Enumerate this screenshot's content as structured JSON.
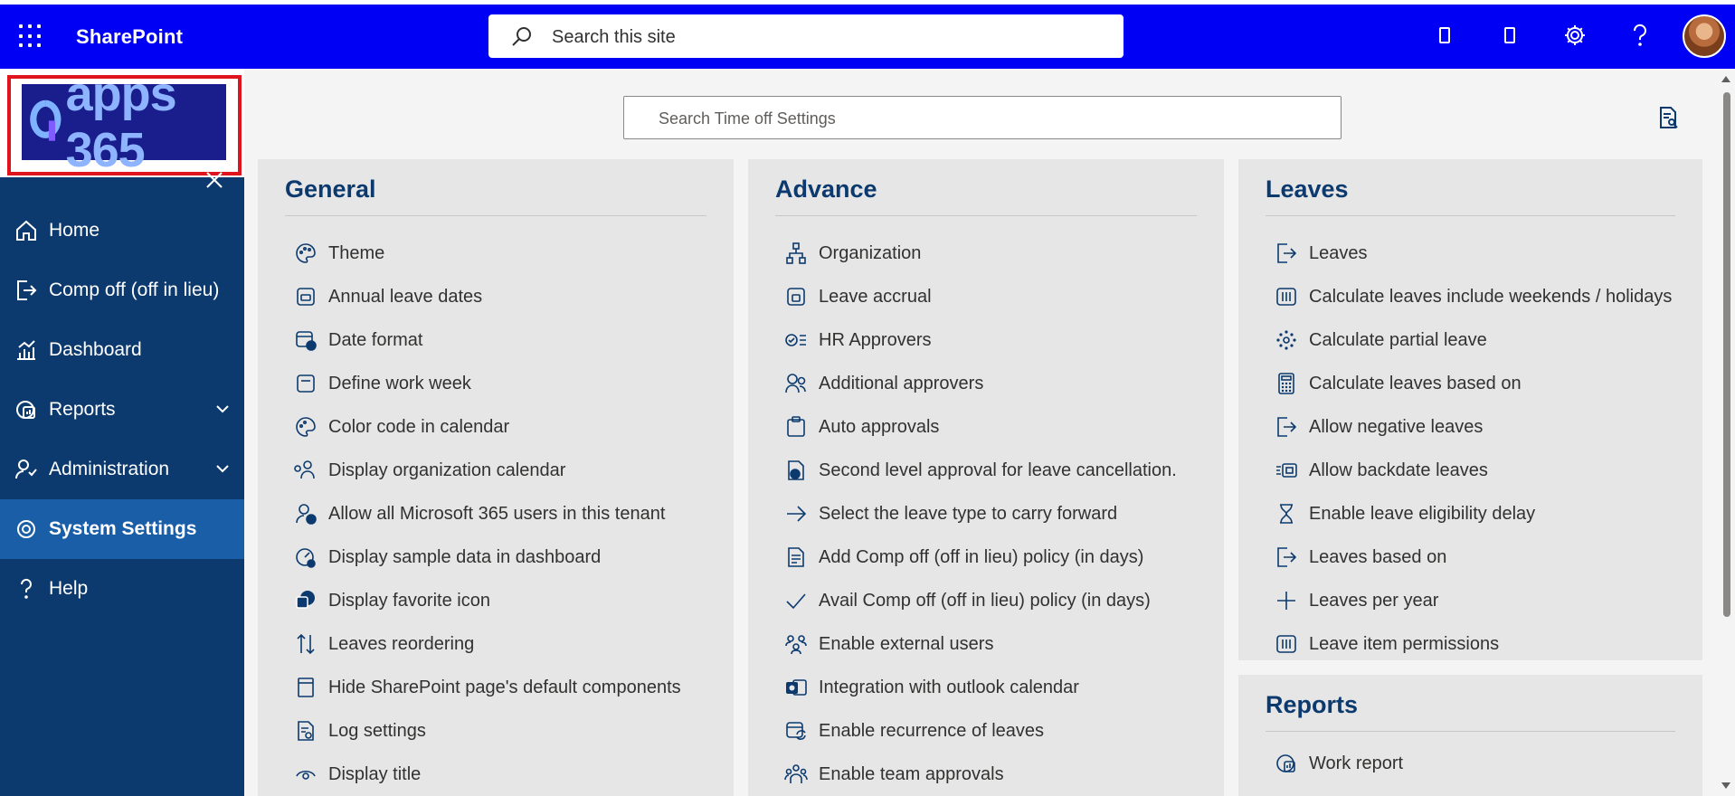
{
  "suitebar": {
    "app_name": "SharePoint",
    "search_placeholder": "Search this site",
    "icons": [
      "waffle-icon",
      "search-icon",
      "mobile-icon",
      "mobile-icon",
      "gear-icon",
      "help-icon",
      "avatar"
    ],
    "background": "#0000f5"
  },
  "leftnav": {
    "logo_text": "apps 365",
    "items": [
      {
        "label": "Home",
        "icon": "home-icon"
      },
      {
        "label": "Comp off (off in lieu)",
        "icon": "signout-icon"
      },
      {
        "label": "Dashboard",
        "icon": "chart-icon"
      },
      {
        "label": "Reports",
        "icon": "report-icon",
        "expandable": true
      },
      {
        "label": "Administration",
        "icon": "admin-icon",
        "expandable": true
      },
      {
        "label": "System Settings",
        "icon": "gear-icon",
        "active": true
      },
      {
        "label": "Help",
        "icon": "help-icon"
      }
    ],
    "background": "#0c3a6e",
    "active_background": "#1a5ea8"
  },
  "main": {
    "search_placeholder": "Search Time off Settings",
    "panels": [
      {
        "title": "General",
        "items": [
          {
            "label": "Theme",
            "icon": "palette-icon"
          },
          {
            "label": "Annual leave dates",
            "icon": "calendar-icon"
          },
          {
            "label": "Date format",
            "icon": "calendar-clock-icon"
          },
          {
            "label": "Define work week",
            "icon": "calendar-icon"
          },
          {
            "label": "Color code in calendar",
            "icon": "palette-icon"
          },
          {
            "label": "Display organization calendar",
            "icon": "people-icon"
          },
          {
            "label": "Allow all Microsoft 365 users in this tenant",
            "icon": "person-check-icon"
          },
          {
            "label": "Display sample data in dashboard",
            "icon": "gauge-icon"
          },
          {
            "label": "Display favorite icon",
            "icon": "sharepoint-icon"
          },
          {
            "label": "Leaves reordering",
            "icon": "sort-icon"
          },
          {
            "label": "Hide SharePoint page's default components",
            "icon": "window-icon"
          },
          {
            "label": "Log settings",
            "icon": "document-search-icon"
          },
          {
            "label": "Display title",
            "icon": "eye-icon"
          }
        ]
      },
      {
        "title": "Advance",
        "items": [
          {
            "label": "Organization",
            "icon": "org-chart-icon"
          },
          {
            "label": "Leave accrual",
            "icon": "calendar-icon"
          },
          {
            "label": "HR Approvers",
            "icon": "checklist-icon"
          },
          {
            "label": "Additional approvers",
            "icon": "people-icon"
          },
          {
            "label": "Auto approvals",
            "icon": "clipboard-icon"
          },
          {
            "label": "Second level approval for leave cancellation.",
            "icon": "document-check-icon"
          },
          {
            "label": "Select the leave type to carry forward",
            "icon": "arrow-right-icon"
          },
          {
            "label": "Add Comp off (off in lieu) policy (in days)",
            "icon": "document-add-icon"
          },
          {
            "label": "Avail Comp off (off in lieu) policy (in days)",
            "icon": "checkmark-icon"
          },
          {
            "label": "Enable external users",
            "icon": "people-external-icon"
          },
          {
            "label": "Integration with outlook calendar",
            "icon": "outlook-icon"
          },
          {
            "label": "Enable recurrence of leaves",
            "icon": "calendar-sync-icon"
          },
          {
            "label": "Enable team approvals",
            "icon": "team-icon"
          }
        ]
      },
      {
        "title": "Leaves",
        "items": [
          {
            "label": "Leaves",
            "icon": "signout-icon"
          },
          {
            "label": "Calculate leaves include weekends / holidays",
            "icon": "columns-icon"
          },
          {
            "label": "Calculate partial leave",
            "icon": "dots-circle-icon"
          },
          {
            "label": "Calculate leaves based on",
            "icon": "calculator-icon"
          },
          {
            "label": "Allow negative leaves",
            "icon": "signout-icon"
          },
          {
            "label": "Allow backdate leaves",
            "icon": "backdate-icon"
          },
          {
            "label": "Enable leave eligibility delay",
            "icon": "hourglass-icon"
          },
          {
            "label": "Leaves based on",
            "icon": "signout-icon"
          },
          {
            "label": "Leaves per year",
            "icon": "plus-icon"
          },
          {
            "label": "Leave item permissions",
            "icon": "columns-icon"
          }
        ]
      },
      {
        "title": "Reports",
        "items": [
          {
            "label": "Work report",
            "icon": "report-icon"
          }
        ]
      }
    ],
    "panel_background": "#e6e6e6",
    "heading_color": "#0c3a6e"
  }
}
